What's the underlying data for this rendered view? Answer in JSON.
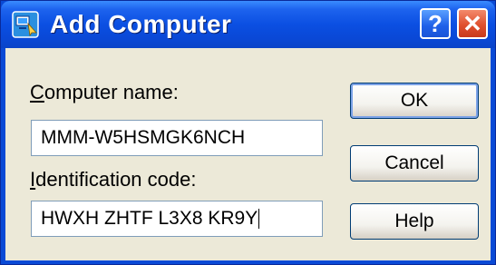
{
  "window": {
    "title": "Add Computer",
    "title_icon": "computer-app-icon"
  },
  "titlebar_buttons": {
    "help": "?",
    "close": "✕"
  },
  "form": {
    "computer_name": {
      "label_mnemonic": "C",
      "label_rest": "omputer name:",
      "value": "MMM-W5HSMGK6NCH"
    },
    "identification_code": {
      "label_mnemonic": "I",
      "label_rest": "dentification code:",
      "value": "HWXH ZHTF L3X8 KR9Y"
    }
  },
  "buttons": {
    "ok": "OK",
    "cancel": "Cancel",
    "help": "Help"
  },
  "colors": {
    "titlebar": "#0a4ad6",
    "client": "#ece9d8",
    "close": "#e0502e"
  }
}
